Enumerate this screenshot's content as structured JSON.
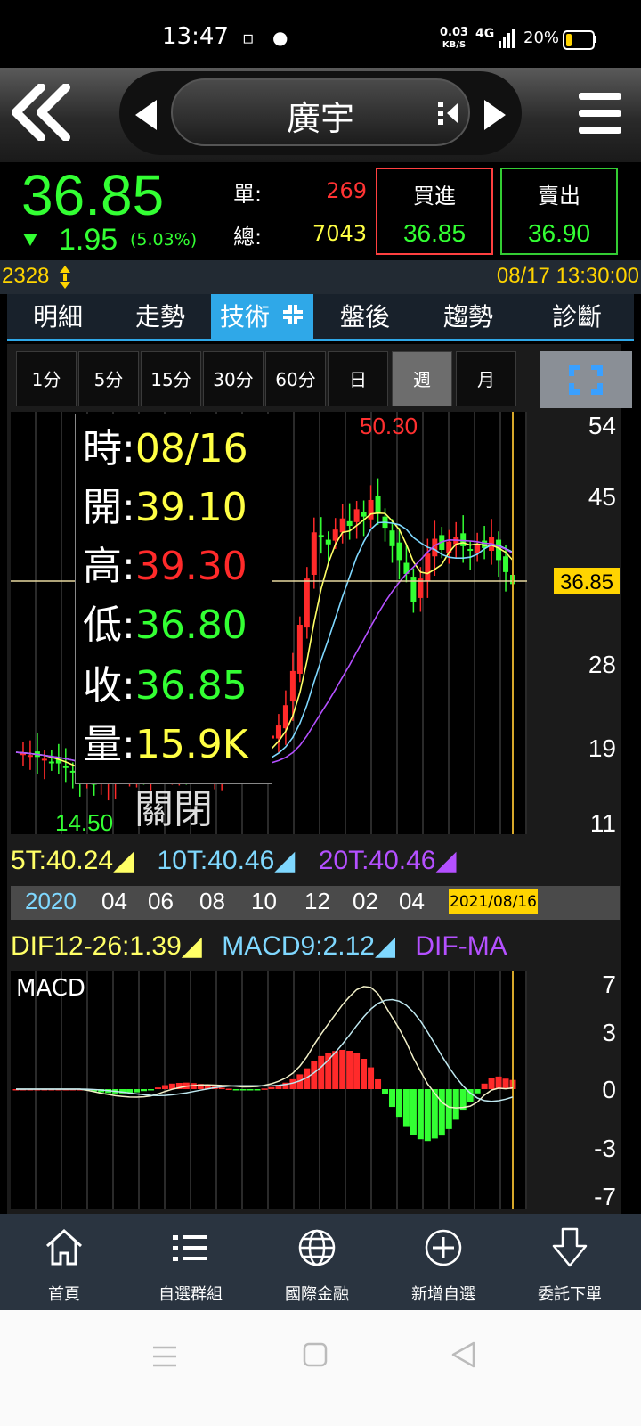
{
  "status_bar": {
    "time": "13:47",
    "net_speed_value": "0.03",
    "net_speed_unit": "KB/S",
    "signal": "4G",
    "battery": "20%"
  },
  "header": {
    "stock_name": "廣宇"
  },
  "quote": {
    "price": "36.85",
    "change": "1.95",
    "change_pct": "(5.03%)",
    "unit_label": "單:",
    "unit_value": "269",
    "total_label": "總:",
    "total_value": "7043",
    "buy_label": "買進",
    "buy_price": "36.85",
    "sell_label": "賣出",
    "sell_price": "36.90"
  },
  "info_bar": {
    "code": "2328",
    "datetime": "08/17 13:30:00"
  },
  "tabs": [
    "明細",
    "走勢",
    "技術",
    "盤後",
    "趨勢",
    "診斷"
  ],
  "active_tab": "技術",
  "periods": [
    "1分",
    "5分",
    "15分",
    "30分",
    "60分",
    "日",
    "週",
    "月"
  ],
  "active_period": "週",
  "ohlc_box": {
    "time_label": "時:",
    "time_value": "08/16",
    "open_label": "開:",
    "open_value": "39.10",
    "high_label": "高:",
    "high_value": "39.30",
    "low_label": "低:",
    "low_value": "36.80",
    "close_label": "收:",
    "close_value": "36.85",
    "volume_label": "量:",
    "volume_value": "15.9K",
    "close_button": "關閉"
  },
  "price_chart": {
    "y_ticks": [
      "54",
      "45",
      "28",
      "19",
      "11"
    ],
    "current_price_tag": "36.85",
    "max_label": "50.30",
    "min_label": "14.50"
  },
  "ma_legend": {
    "ma5": "5T:40.24",
    "ma10": "10T:40.46",
    "ma20": "20T:40.46"
  },
  "date_axis": {
    "labels": [
      "2020",
      "04",
      "06",
      "08",
      "10",
      "12",
      "02",
      "04"
    ],
    "selected_date": "2021/08/16"
  },
  "macd_legend": {
    "dif": "DIF12-26:1.39",
    "macd9": "MACD9:2.12",
    "dif_ma": "DIF-MA"
  },
  "macd_chart": {
    "title": "MACD",
    "y_ticks": [
      "7",
      "3",
      "0",
      "-3",
      "-7"
    ]
  },
  "colors": {
    "up": "#ff2a2a",
    "down": "#33ff33",
    "ma5": "#ffff66",
    "ma10": "#7fd8ff",
    "ma20": "#b450ff",
    "accent": "#2fa8e8",
    "highlight": "#ffd400"
  },
  "bottom_nav": [
    {
      "label": "首頁",
      "icon": "home-icon"
    },
    {
      "label": "自選群組",
      "icon": "list-icon"
    },
    {
      "label": "國際金融",
      "icon": "globe-icon"
    },
    {
      "label": "新增自選",
      "icon": "plus-circle-icon"
    },
    {
      "label": "委託下單",
      "icon": "down-arrow-icon"
    }
  ]
}
